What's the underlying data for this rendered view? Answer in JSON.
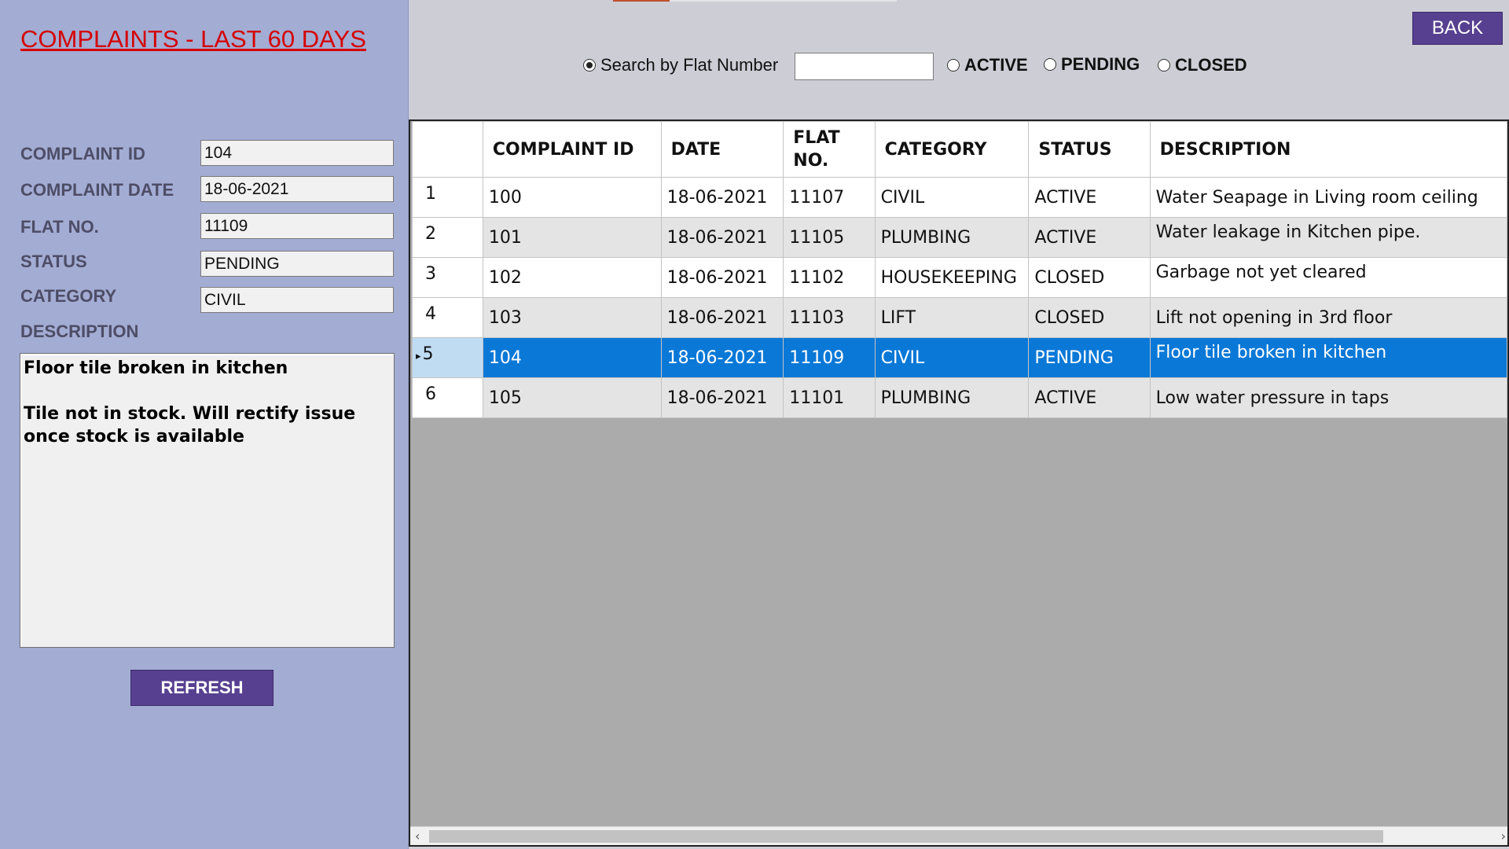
{
  "title": "COMPLAINTS - LAST 60 DAYS",
  "details": {
    "complaint_id_label": "COMPLAINT ID",
    "complaint_id": "104",
    "complaint_date_label": "COMPLAINT DATE",
    "complaint_date": "18-06-2021",
    "flat_no_label": "FLAT NO.",
    "flat_no": "11109",
    "status_label": "STATUS",
    "status": "PENDING",
    "category_label": "CATEGORY",
    "category": "CIVIL",
    "description_label": "DESCRIPTION",
    "description": "Floor tile broken in kitchen\n\nTile not in stock. Will rectify issue once stock is available"
  },
  "buttons": {
    "refresh": "REFRESH",
    "back": "BACK"
  },
  "filters": {
    "search_label": "Search by Flat Number",
    "search_value": "",
    "active": "ACTIVE",
    "pending": "PENDING",
    "closed": "CLOSED",
    "selected": "search"
  },
  "grid": {
    "columns": [
      "COMPLAINT ID",
      "DATE",
      "FLAT NO.",
      "CATEGORY",
      "STATUS",
      "DESCRIPTION"
    ],
    "rows": [
      {
        "n": "1",
        "id": "100",
        "date": "18-06-2021",
        "flat": "11107",
        "category": "CIVIL",
        "status": "ACTIVE",
        "description": "Water Seapage in Living room ceiling"
      },
      {
        "n": "2",
        "id": "101",
        "date": "18-06-2021",
        "flat": "11105",
        "category": "PLUMBING",
        "status": "ACTIVE",
        "description": "Water leakage in Kitchen pipe."
      },
      {
        "n": "3",
        "id": "102",
        "date": "18-06-2021",
        "flat": "11102",
        "category": "HOUSEKEEPING",
        "status": "CLOSED",
        "description": "Garbage not yet cleared"
      },
      {
        "n": "4",
        "id": "103",
        "date": "18-06-2021",
        "flat": "11103",
        "category": "LIFT",
        "status": "CLOSED",
        "description": "Lift not opening in 3rd floor"
      },
      {
        "n": "5",
        "id": "104",
        "date": "18-06-2021",
        "flat": "11109",
        "category": "CIVIL",
        "status": "PENDING",
        "description": "Floor tile broken in kitchen"
      },
      {
        "n": "6",
        "id": "105",
        "date": "18-06-2021",
        "flat": "11101",
        "category": "PLUMBING",
        "status": "ACTIVE",
        "description": "Low water pressure in taps"
      }
    ],
    "selected_row": "5"
  },
  "colors": {
    "panel_bg": "#a3acd3",
    "title": "#d40000",
    "button": "#574090",
    "selection": "#0a78d7"
  }
}
